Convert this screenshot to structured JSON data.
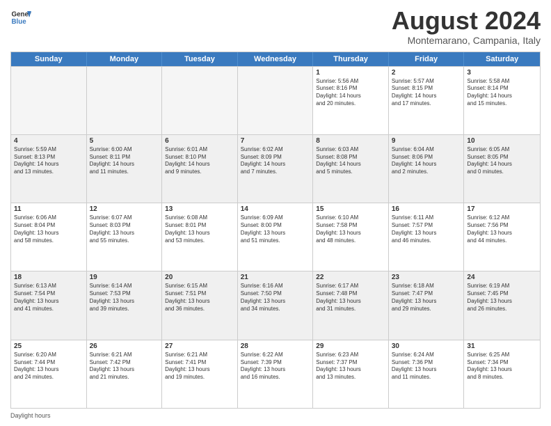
{
  "header": {
    "logo_line1": "General",
    "logo_line2": "Blue",
    "month_title": "August 2024",
    "location": "Montemarano, Campania, Italy"
  },
  "weekdays": [
    "Sunday",
    "Monday",
    "Tuesday",
    "Wednesday",
    "Thursday",
    "Friday",
    "Saturday"
  ],
  "footer": {
    "daylight_label": "Daylight hours"
  },
  "weeks": [
    [
      {
        "day": "",
        "info": "",
        "empty": true
      },
      {
        "day": "",
        "info": "",
        "empty": true
      },
      {
        "day": "",
        "info": "",
        "empty": true
      },
      {
        "day": "",
        "info": "",
        "empty": true
      },
      {
        "day": "1",
        "info": "Sunrise: 5:56 AM\nSunset: 8:16 PM\nDaylight: 14 hours\nand 20 minutes.",
        "empty": false
      },
      {
        "day": "2",
        "info": "Sunrise: 5:57 AM\nSunset: 8:15 PM\nDaylight: 14 hours\nand 17 minutes.",
        "empty": false
      },
      {
        "day": "3",
        "info": "Sunrise: 5:58 AM\nSunset: 8:14 PM\nDaylight: 14 hours\nand 15 minutes.",
        "empty": false
      }
    ],
    [
      {
        "day": "4",
        "info": "Sunrise: 5:59 AM\nSunset: 8:13 PM\nDaylight: 14 hours\nand 13 minutes.",
        "empty": false
      },
      {
        "day": "5",
        "info": "Sunrise: 6:00 AM\nSunset: 8:11 PM\nDaylight: 14 hours\nand 11 minutes.",
        "empty": false
      },
      {
        "day": "6",
        "info": "Sunrise: 6:01 AM\nSunset: 8:10 PM\nDaylight: 14 hours\nand 9 minutes.",
        "empty": false
      },
      {
        "day": "7",
        "info": "Sunrise: 6:02 AM\nSunset: 8:09 PM\nDaylight: 14 hours\nand 7 minutes.",
        "empty": false
      },
      {
        "day": "8",
        "info": "Sunrise: 6:03 AM\nSunset: 8:08 PM\nDaylight: 14 hours\nand 5 minutes.",
        "empty": false
      },
      {
        "day": "9",
        "info": "Sunrise: 6:04 AM\nSunset: 8:06 PM\nDaylight: 14 hours\nand 2 minutes.",
        "empty": false
      },
      {
        "day": "10",
        "info": "Sunrise: 6:05 AM\nSunset: 8:05 PM\nDaylight: 14 hours\nand 0 minutes.",
        "empty": false
      }
    ],
    [
      {
        "day": "11",
        "info": "Sunrise: 6:06 AM\nSunset: 8:04 PM\nDaylight: 13 hours\nand 58 minutes.",
        "empty": false
      },
      {
        "day": "12",
        "info": "Sunrise: 6:07 AM\nSunset: 8:03 PM\nDaylight: 13 hours\nand 55 minutes.",
        "empty": false
      },
      {
        "day": "13",
        "info": "Sunrise: 6:08 AM\nSunset: 8:01 PM\nDaylight: 13 hours\nand 53 minutes.",
        "empty": false
      },
      {
        "day": "14",
        "info": "Sunrise: 6:09 AM\nSunset: 8:00 PM\nDaylight: 13 hours\nand 51 minutes.",
        "empty": false
      },
      {
        "day": "15",
        "info": "Sunrise: 6:10 AM\nSunset: 7:58 PM\nDaylight: 13 hours\nand 48 minutes.",
        "empty": false
      },
      {
        "day": "16",
        "info": "Sunrise: 6:11 AM\nSunset: 7:57 PM\nDaylight: 13 hours\nand 46 minutes.",
        "empty": false
      },
      {
        "day": "17",
        "info": "Sunrise: 6:12 AM\nSunset: 7:56 PM\nDaylight: 13 hours\nand 44 minutes.",
        "empty": false
      }
    ],
    [
      {
        "day": "18",
        "info": "Sunrise: 6:13 AM\nSunset: 7:54 PM\nDaylight: 13 hours\nand 41 minutes.",
        "empty": false
      },
      {
        "day": "19",
        "info": "Sunrise: 6:14 AM\nSunset: 7:53 PM\nDaylight: 13 hours\nand 39 minutes.",
        "empty": false
      },
      {
        "day": "20",
        "info": "Sunrise: 6:15 AM\nSunset: 7:51 PM\nDaylight: 13 hours\nand 36 minutes.",
        "empty": false
      },
      {
        "day": "21",
        "info": "Sunrise: 6:16 AM\nSunset: 7:50 PM\nDaylight: 13 hours\nand 34 minutes.",
        "empty": false
      },
      {
        "day": "22",
        "info": "Sunrise: 6:17 AM\nSunset: 7:48 PM\nDaylight: 13 hours\nand 31 minutes.",
        "empty": false
      },
      {
        "day": "23",
        "info": "Sunrise: 6:18 AM\nSunset: 7:47 PM\nDaylight: 13 hours\nand 29 minutes.",
        "empty": false
      },
      {
        "day": "24",
        "info": "Sunrise: 6:19 AM\nSunset: 7:45 PM\nDaylight: 13 hours\nand 26 minutes.",
        "empty": false
      }
    ],
    [
      {
        "day": "25",
        "info": "Sunrise: 6:20 AM\nSunset: 7:44 PM\nDaylight: 13 hours\nand 24 minutes.",
        "empty": false
      },
      {
        "day": "26",
        "info": "Sunrise: 6:21 AM\nSunset: 7:42 PM\nDaylight: 13 hours\nand 21 minutes.",
        "empty": false
      },
      {
        "day": "27",
        "info": "Sunrise: 6:21 AM\nSunset: 7:41 PM\nDaylight: 13 hours\nand 19 minutes.",
        "empty": false
      },
      {
        "day": "28",
        "info": "Sunrise: 6:22 AM\nSunset: 7:39 PM\nDaylight: 13 hours\nand 16 minutes.",
        "empty": false
      },
      {
        "day": "29",
        "info": "Sunrise: 6:23 AM\nSunset: 7:37 PM\nDaylight: 13 hours\nand 13 minutes.",
        "empty": false
      },
      {
        "day": "30",
        "info": "Sunrise: 6:24 AM\nSunset: 7:36 PM\nDaylight: 13 hours\nand 11 minutes.",
        "empty": false
      },
      {
        "day": "31",
        "info": "Sunrise: 6:25 AM\nSunset: 7:34 PM\nDaylight: 13 hours\nand 8 minutes.",
        "empty": false
      }
    ]
  ]
}
